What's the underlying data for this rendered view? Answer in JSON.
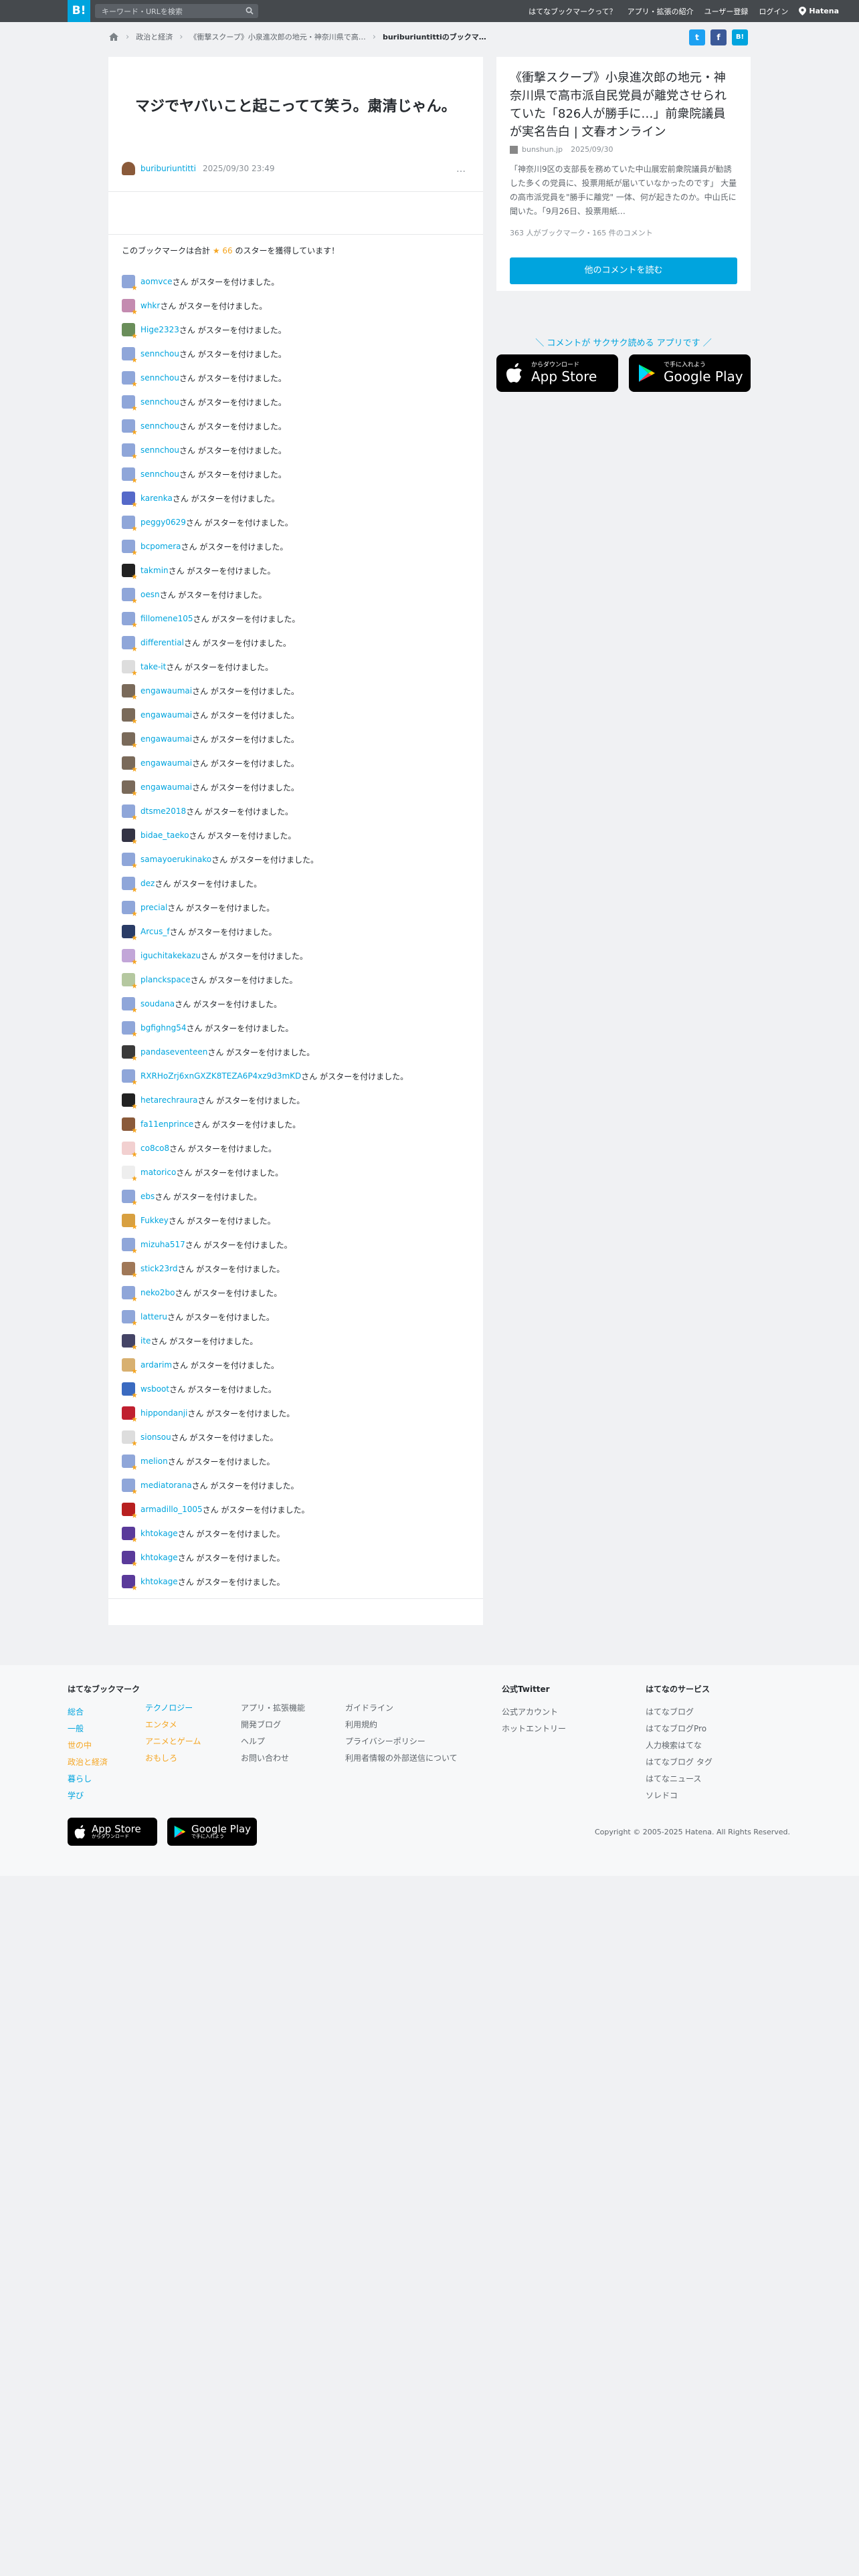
{
  "header": {
    "logo": "B!",
    "search_placeholder": "キーワード・URLを検索",
    "nav": [
      "はてなブックマークって？",
      "アプリ・拡張の紹介",
      "ユーザー登録",
      "ログイン"
    ],
    "brand": "Hatena"
  },
  "breadcrumb": {
    "items": [
      "政治と経済",
      "《衝撃スクープ》小泉進次郎の地元・神奈川県で高…"
    ],
    "current": "buriburiuntittiのブックマ…"
  },
  "share": {
    "twitter": "t",
    "facebook": "f",
    "hatena": "B!"
  },
  "bookmark": {
    "comment": "マジでヤバいこと起こってて笑う。粛清じゃん。",
    "user": "buriburiuntitti",
    "date": "2025/09/30 23:49",
    "menu": "…"
  },
  "stars": {
    "total_prefix": "このブックマークは合計",
    "total_star": "★ 66",
    "total_suffix": "のスターを獲得しています！",
    "suffix": "さん がスターを付けました。",
    "users": [
      "aomvce",
      "whkr",
      "Hige2323",
      "sennchou",
      "sennchou",
      "sennchou",
      "sennchou",
      "sennchou",
      "sennchou",
      "karenka",
      "peggy0629",
      "bcpomera",
      "takmin",
      "oesn",
      "fillomene105",
      "differential",
      "take-it",
      "engawaumai",
      "engawaumai",
      "engawaumai",
      "engawaumai",
      "engawaumai",
      "dtsme2018",
      "bidae_taeko",
      "samayoerukinako",
      "dez",
      "precial",
      "Arcus_f",
      "iguchitakekazu",
      "planckspace",
      "soudana",
      "bgfighng54",
      "pandaseventeen",
      "RXRHoZrj6xnGXZK8TEZA6P4xz9d3mKD",
      "hetarechraura",
      "fa11enprince",
      "co8co8",
      "matorico",
      "ebs",
      "Fukkey",
      "mizuha517",
      "stick23rd",
      "neko2bo",
      "latteru",
      "ite",
      "ardarim",
      "wsboot",
      "hippondanji",
      "sionsou",
      "melion",
      "mediatorana",
      "armadillo_1005",
      "khtokage",
      "khtokage",
      "khtokage"
    ],
    "avatar_colors": [
      "#8fa6d9",
      "#c48bb0",
      "#6a8e5a",
      "#8fa6d9",
      "#8fa6d9",
      "#8fa6d9",
      "#8fa6d9",
      "#8fa6d9",
      "#8fa6d9",
      "#5569c9",
      "#8fa6d9",
      "#8fa6d9",
      "#222222",
      "#8fa6d9",
      "#8fa6d9",
      "#8fa6d9",
      "#dddddd",
      "#7a6a5a",
      "#7a6a5a",
      "#7a6a5a",
      "#7a6a5a",
      "#7a6a5a",
      "#8fa6d9",
      "#333344",
      "#8fa6d9",
      "#8fa6d9",
      "#8fa6d9",
      "#2a3c66",
      "#c2a6d8",
      "#b5c8a0",
      "#8fa6d9",
      "#8fa6d9",
      "#3a3a3a",
      "#8fa6d9",
      "#222222",
      "#8a5a3a",
      "#f2d0d0",
      "#eeeeee",
      "#8fa6d9",
      "#d8a040",
      "#8fa6d9",
      "#a07858",
      "#8fa6d9",
      "#8fa6d9",
      "#444466",
      "#d8b070",
      "#3a6ac0",
      "#c02030",
      "#dddddd",
      "#8fa6d9",
      "#8fa6d9",
      "#b82020",
      "#5a3a9a",
      "#5a3a9a",
      "#5a3a9a"
    ]
  },
  "entry": {
    "title": "《衝撃スクープ》小泉進次郎の地元・神奈川県で高市派自民党員が離党させられていた「826人が勝手に…」前衆院議員が実名告白 | 文春オンライン",
    "source": "bunshun.jp",
    "date": "2025/09/30",
    "description": "「神奈川9区の支部長を務めていた中山展宏前衆院議員が勧誘した多くの党員に、投票用紙が届いていなかったのです」 大量の高市派党員を\"勝手に離党\" 一体、何が起きたのか。中山氏に聞いた。「9月26日、投票用紙…",
    "count": "363 人がブックマーク・165 件のコメント",
    "button": "他のコメントを読む"
  },
  "promo": {
    "text": "＼ コメントが サクサク読める アプリです ／",
    "appstore_small": "からダウンロード",
    "appstore_big": "App Store",
    "googleplay_small": "で手に入れよう",
    "googleplay_big": "Google Play"
  },
  "footer": {
    "bookmark_title": "はてなブックマーク",
    "col1": [
      "総合",
      "一般",
      "世の中",
      "政治と経済",
      "暮らし",
      "学び"
    ],
    "col2": [
      "テクノロジー",
      "エンタメ",
      "アニメとゲーム",
      "おもしろ"
    ],
    "col3": [
      "アプリ・拡張機能",
      "開発ブログ",
      "ヘルプ",
      "お問い合わせ"
    ],
    "col4": [
      "ガイドライン",
      "利用規約",
      "プライバシーポリシー",
      "利用者情報の外部送信について"
    ],
    "twitter_title": "公式Twitter",
    "twitter": [
      "公式アカウント",
      "ホットエントリー"
    ],
    "services_title": "はてなのサービス",
    "services": [
      "はてなブログ",
      "はてなブログPro",
      "人力検索はてな",
      "はてなブログ タグ",
      "はてなニュース",
      "ソレドコ"
    ],
    "copyright": "Copyright © 2005-2025 Hatena. All Rights Reserved.",
    "appstore_small": "からダウンロード",
    "appstore_big": "App Store",
    "googleplay_small": "で手に入れよう",
    "googleplay_big": "Google Play"
  },
  "colors": {
    "accent": "#00a4de",
    "header_bg": "#45494d",
    "star": "#f5a623",
    "twitter": "#1da1f2",
    "facebook": "#3b5998"
  }
}
